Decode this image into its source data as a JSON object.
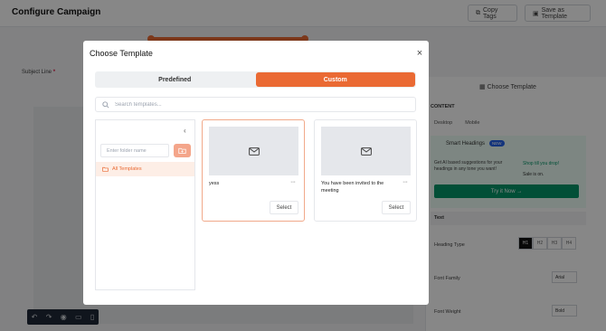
{
  "background": {
    "page_title": "Configure Campaign",
    "copy_tags_label": "Copy Tags",
    "save_as_template_label": "Save as Template",
    "subject_label": "Subject Line",
    "subject_required_mark": "*",
    "choose_template_button": "Choose Template",
    "content_label": "CONTENT",
    "device_tabs": [
      "Desktop",
      "Mobile"
    ],
    "smart_headings_title": "Smart Headings",
    "smart_headings_badge": "NEW",
    "smart_headings_desc": "Get AI based suggestions for your headings in any tone you want!",
    "preview_shop": "Shop till you drop!",
    "preview_sale": "Sale is on.",
    "try_it_now": "Try it Now →",
    "text_section": "Text",
    "heading_type_label": "Heading Type",
    "heading_options": [
      "H1",
      "H2",
      "H3",
      "H4"
    ],
    "font_family_label": "Font Family",
    "font_family_value": "Arial",
    "font_weight_label": "Font Weight",
    "font_weight_value": "Bold"
  },
  "modal": {
    "title": "Choose Template",
    "close_glyph": "×",
    "tabs": [
      {
        "label": "Predefined",
        "active": false
      },
      {
        "label": "Custom",
        "active": true
      }
    ],
    "search_placeholder": "Search templates...",
    "folder_input_placeholder": "Enter folder name",
    "collapse_glyph": "‹",
    "folders": [
      {
        "label": "All Templates",
        "selected": true
      }
    ],
    "templates": [
      {
        "name": "yess",
        "select_label": "Select",
        "more_glyph": "···"
      },
      {
        "name": "You have been invited to the meeting",
        "select_label": "Select",
        "more_glyph": "···"
      }
    ]
  },
  "colors": {
    "accent": "#ea6a33",
    "accent_light": "#fdeee6",
    "ai_green": "#059669",
    "overlay": "rgba(0,0,0,0.47)"
  }
}
